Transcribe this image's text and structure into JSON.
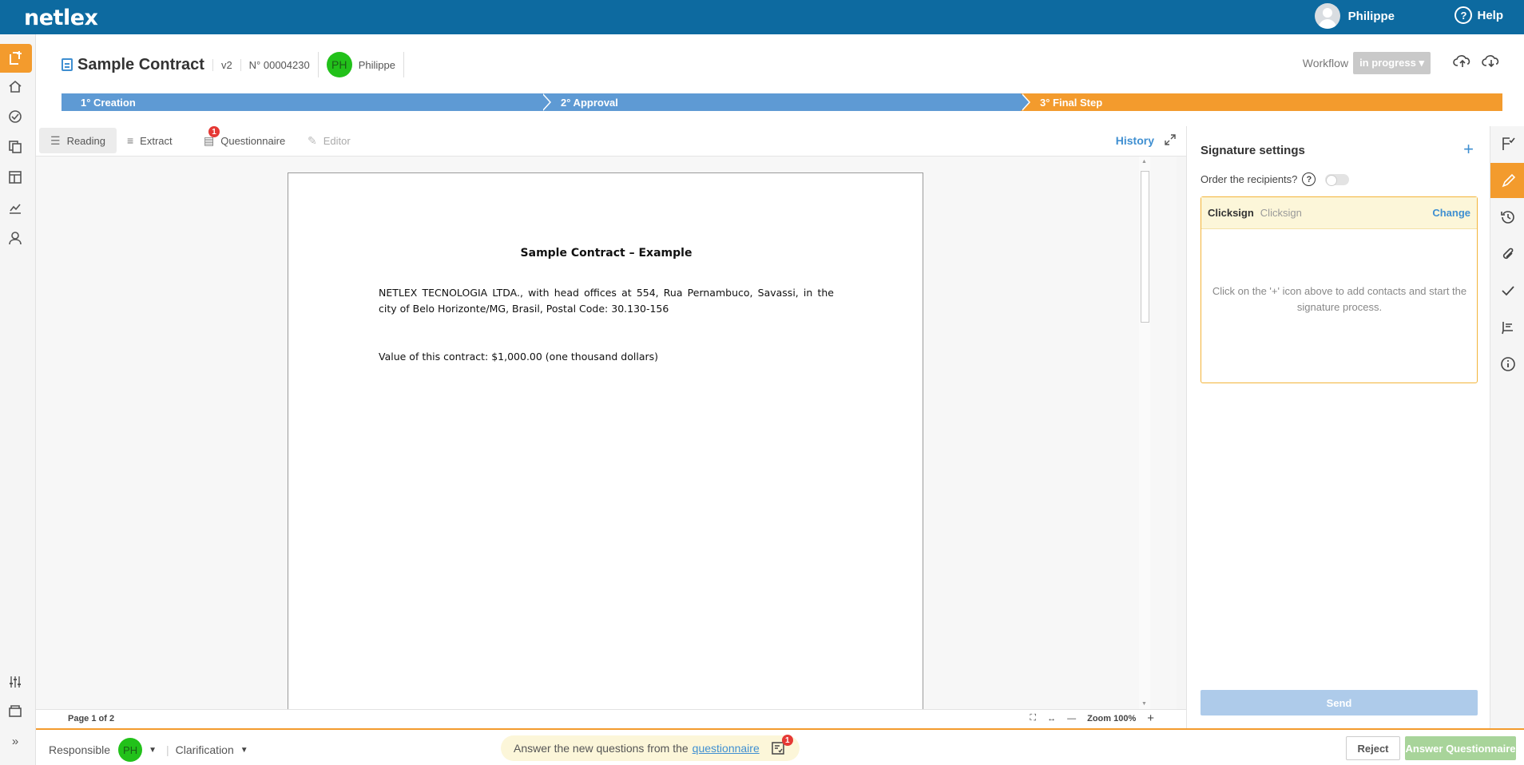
{
  "topbar": {
    "logo": "netlex",
    "user_name": "Philippe",
    "help_label": "Help"
  },
  "document": {
    "title": "Sample Contract",
    "version": "v2",
    "number": "N° 00004230",
    "owner_initials": "PH",
    "owner_name": "Philippe"
  },
  "workflow": {
    "label": "Workflow",
    "status": "in progress"
  },
  "steps": [
    {
      "label": "1° Creation"
    },
    {
      "label": "2° Approval"
    },
    {
      "label": "3° Final Step"
    }
  ],
  "tabs": {
    "reading": "Reading",
    "extract": "Extract",
    "questionnaire": "Questionnaire",
    "questionnaire_badge": "1",
    "editor": "Editor",
    "history": "History"
  },
  "page": {
    "title": "Sample Contract – Example",
    "paragraph1": "NETLEX TECNOLOGIA LTDA., with head offices at 554, Rua Pernambuco, Savassi, in the city of Belo Horizonte/MG, Brasil, Postal Code: 30.130-156",
    "paragraph2": "Value of this contract: $1,000.00 (one thousand dollars)"
  },
  "footer": {
    "page_of": "Page 1 of 2",
    "zoom": "Zoom 100%"
  },
  "signature": {
    "title": "Signature settings",
    "order_label": "Order the recipients?",
    "provider": "Clicksign",
    "provider_sub": "Clicksign",
    "change": "Change",
    "message": "Click on the '+' icon above to add contacts and start the signature process.",
    "send": "Send"
  },
  "bottom": {
    "responsible": "Responsible",
    "responsible_initials": "PH",
    "clarification": "Clarification",
    "notice_text": "Answer the new questions from the",
    "notice_link": "questionnaire",
    "notice_badge": "1",
    "reject": "Reject",
    "answer": "Answer Questionnaire"
  },
  "colors": {
    "topbar": "#0d6aa0",
    "accent_orange": "#f39b2d",
    "step_blue": "#5e9ad4",
    "link_blue": "#3f8fd1",
    "avatar_green": "#22c11a"
  }
}
